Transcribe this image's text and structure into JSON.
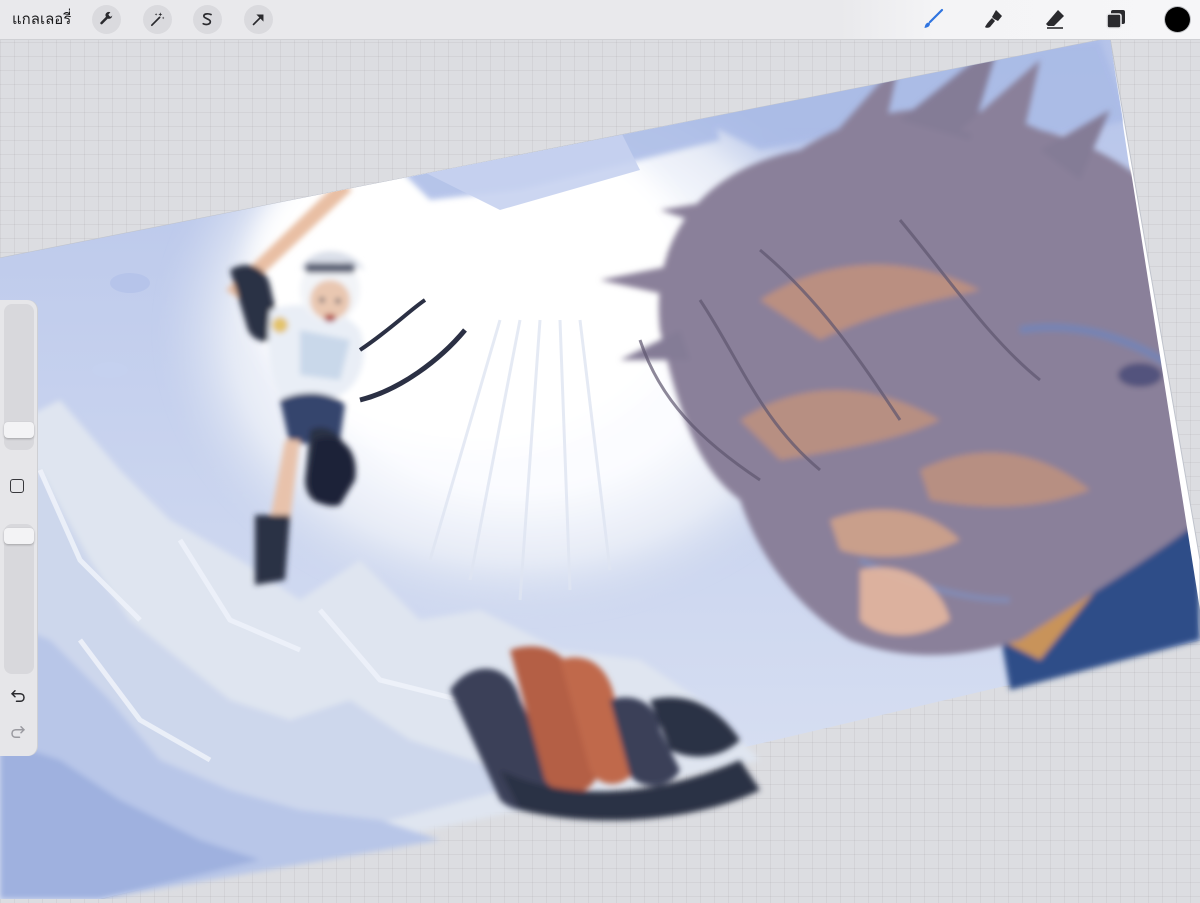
{
  "toolbar": {
    "gallery_label": "แกลเลอรี่",
    "left_tools": [
      {
        "name": "actions",
        "icon": "wrench-icon"
      },
      {
        "name": "adjustments",
        "icon": "magic-wand-icon"
      },
      {
        "name": "selection",
        "icon": "selection-s-icon"
      },
      {
        "name": "transform",
        "icon": "arrow-cursor-icon"
      }
    ],
    "right_tools": [
      {
        "name": "brush",
        "icon": "brush-icon",
        "active": true
      },
      {
        "name": "smudge",
        "icon": "smudge-icon"
      },
      {
        "name": "eraser",
        "icon": "eraser-icon"
      },
      {
        "name": "layers",
        "icon": "layers-icon"
      }
    ],
    "current_color": "#000000",
    "active_color": "#2f74e0"
  },
  "sidebar": {
    "brush_size_level": 0.09,
    "opacity_level": 0.97,
    "modify_icon": "square-icon",
    "undo_icon": "undo-icon",
    "redo_icon": "redo-icon"
  },
  "canvas": {
    "artwork_icon": "painting-artwork",
    "palette": {
      "sky_light": "#c8d4f0",
      "sky_blue": "#a7b8e6",
      "snow": "#eef1f7",
      "glow": "#ffffff",
      "hair": "#8a809a",
      "hair_warm": "#c2927c",
      "cloak": "#2f4e88",
      "dark": "#2b3044",
      "skin": "#e4b69e"
    }
  }
}
